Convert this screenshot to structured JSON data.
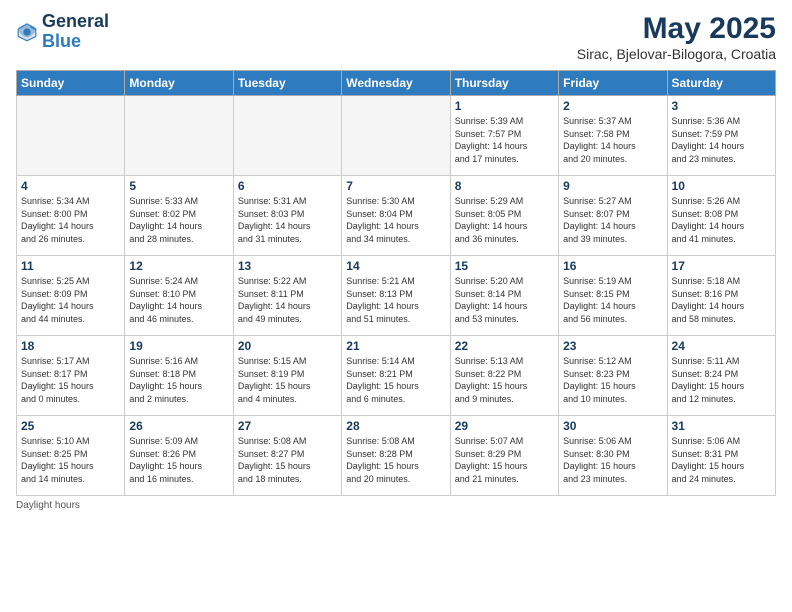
{
  "header": {
    "logo_general": "General",
    "logo_blue": "Blue",
    "month_title": "May 2025",
    "location": "Sirac, Bjelovar-Bilogora, Croatia"
  },
  "weekdays": [
    "Sunday",
    "Monday",
    "Tuesday",
    "Wednesday",
    "Thursday",
    "Friday",
    "Saturday"
  ],
  "weeks": [
    [
      {
        "day": "",
        "info": ""
      },
      {
        "day": "",
        "info": ""
      },
      {
        "day": "",
        "info": ""
      },
      {
        "day": "",
        "info": ""
      },
      {
        "day": "1",
        "info": "Sunrise: 5:39 AM\nSunset: 7:57 PM\nDaylight: 14 hours\nand 17 minutes."
      },
      {
        "day": "2",
        "info": "Sunrise: 5:37 AM\nSunset: 7:58 PM\nDaylight: 14 hours\nand 20 minutes."
      },
      {
        "day": "3",
        "info": "Sunrise: 5:36 AM\nSunset: 7:59 PM\nDaylight: 14 hours\nand 23 minutes."
      }
    ],
    [
      {
        "day": "4",
        "info": "Sunrise: 5:34 AM\nSunset: 8:00 PM\nDaylight: 14 hours\nand 26 minutes."
      },
      {
        "day": "5",
        "info": "Sunrise: 5:33 AM\nSunset: 8:02 PM\nDaylight: 14 hours\nand 28 minutes."
      },
      {
        "day": "6",
        "info": "Sunrise: 5:31 AM\nSunset: 8:03 PM\nDaylight: 14 hours\nand 31 minutes."
      },
      {
        "day": "7",
        "info": "Sunrise: 5:30 AM\nSunset: 8:04 PM\nDaylight: 14 hours\nand 34 minutes."
      },
      {
        "day": "8",
        "info": "Sunrise: 5:29 AM\nSunset: 8:05 PM\nDaylight: 14 hours\nand 36 minutes."
      },
      {
        "day": "9",
        "info": "Sunrise: 5:27 AM\nSunset: 8:07 PM\nDaylight: 14 hours\nand 39 minutes."
      },
      {
        "day": "10",
        "info": "Sunrise: 5:26 AM\nSunset: 8:08 PM\nDaylight: 14 hours\nand 41 minutes."
      }
    ],
    [
      {
        "day": "11",
        "info": "Sunrise: 5:25 AM\nSunset: 8:09 PM\nDaylight: 14 hours\nand 44 minutes."
      },
      {
        "day": "12",
        "info": "Sunrise: 5:24 AM\nSunset: 8:10 PM\nDaylight: 14 hours\nand 46 minutes."
      },
      {
        "day": "13",
        "info": "Sunrise: 5:22 AM\nSunset: 8:11 PM\nDaylight: 14 hours\nand 49 minutes."
      },
      {
        "day": "14",
        "info": "Sunrise: 5:21 AM\nSunset: 8:13 PM\nDaylight: 14 hours\nand 51 minutes."
      },
      {
        "day": "15",
        "info": "Sunrise: 5:20 AM\nSunset: 8:14 PM\nDaylight: 14 hours\nand 53 minutes."
      },
      {
        "day": "16",
        "info": "Sunrise: 5:19 AM\nSunset: 8:15 PM\nDaylight: 14 hours\nand 56 minutes."
      },
      {
        "day": "17",
        "info": "Sunrise: 5:18 AM\nSunset: 8:16 PM\nDaylight: 14 hours\nand 58 minutes."
      }
    ],
    [
      {
        "day": "18",
        "info": "Sunrise: 5:17 AM\nSunset: 8:17 PM\nDaylight: 15 hours\nand 0 minutes."
      },
      {
        "day": "19",
        "info": "Sunrise: 5:16 AM\nSunset: 8:18 PM\nDaylight: 15 hours\nand 2 minutes."
      },
      {
        "day": "20",
        "info": "Sunrise: 5:15 AM\nSunset: 8:19 PM\nDaylight: 15 hours\nand 4 minutes."
      },
      {
        "day": "21",
        "info": "Sunrise: 5:14 AM\nSunset: 8:21 PM\nDaylight: 15 hours\nand 6 minutes."
      },
      {
        "day": "22",
        "info": "Sunrise: 5:13 AM\nSunset: 8:22 PM\nDaylight: 15 hours\nand 9 minutes."
      },
      {
        "day": "23",
        "info": "Sunrise: 5:12 AM\nSunset: 8:23 PM\nDaylight: 15 hours\nand 10 minutes."
      },
      {
        "day": "24",
        "info": "Sunrise: 5:11 AM\nSunset: 8:24 PM\nDaylight: 15 hours\nand 12 minutes."
      }
    ],
    [
      {
        "day": "25",
        "info": "Sunrise: 5:10 AM\nSunset: 8:25 PM\nDaylight: 15 hours\nand 14 minutes."
      },
      {
        "day": "26",
        "info": "Sunrise: 5:09 AM\nSunset: 8:26 PM\nDaylight: 15 hours\nand 16 minutes."
      },
      {
        "day": "27",
        "info": "Sunrise: 5:08 AM\nSunset: 8:27 PM\nDaylight: 15 hours\nand 18 minutes."
      },
      {
        "day": "28",
        "info": "Sunrise: 5:08 AM\nSunset: 8:28 PM\nDaylight: 15 hours\nand 20 minutes."
      },
      {
        "day": "29",
        "info": "Sunrise: 5:07 AM\nSunset: 8:29 PM\nDaylight: 15 hours\nand 21 minutes."
      },
      {
        "day": "30",
        "info": "Sunrise: 5:06 AM\nSunset: 8:30 PM\nDaylight: 15 hours\nand 23 minutes."
      },
      {
        "day": "31",
        "info": "Sunrise: 5:06 AM\nSunset: 8:31 PM\nDaylight: 15 hours\nand 24 minutes."
      }
    ]
  ],
  "footer": {
    "note": "Daylight hours"
  }
}
